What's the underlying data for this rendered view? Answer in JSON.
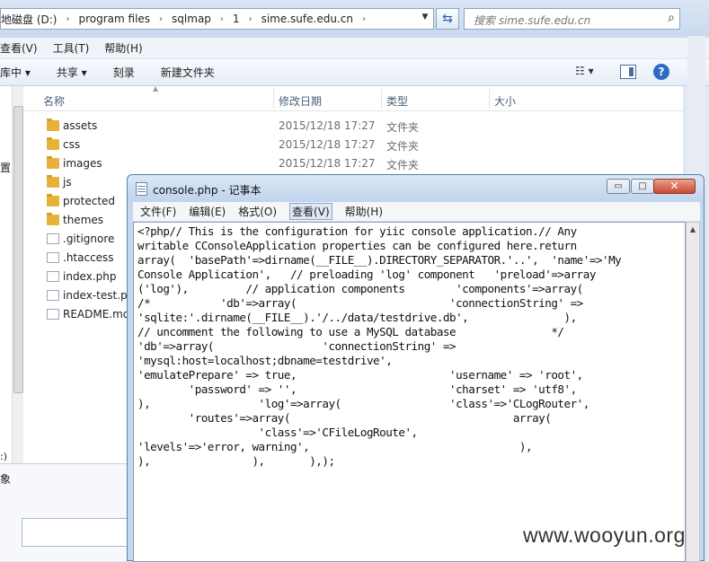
{
  "explorer": {
    "address": {
      "crumbs": [
        "地磁盘 (D:)",
        "program files",
        "sqlmap",
        "1",
        "sime.sufe.edu.cn"
      ],
      "separator": "›"
    },
    "search_placeholder": "搜索 sime.sufe.edu.cn",
    "menu": [
      "查看(V)",
      "工具(T)",
      "帮助(H)"
    ],
    "toolbar": [
      "库中 ▾",
      "共享 ▾",
      "刻录",
      "新建文件夹"
    ],
    "columns": {
      "name": "名称",
      "date": "修改日期",
      "type": "类型",
      "size": "大小"
    },
    "files": [
      {
        "name": "assets",
        "date": "2015/12/18 17:27",
        "type": "文件夹",
        "kind": "folder"
      },
      {
        "name": "css",
        "date": "2015/12/18 17:27",
        "type": "文件夹",
        "kind": "folder"
      },
      {
        "name": "images",
        "date": "2015/12/18 17:27",
        "type": "文件夹",
        "kind": "folder"
      },
      {
        "name": "js",
        "date": "",
        "type": "",
        "kind": "folder"
      },
      {
        "name": "protected",
        "date": "",
        "type": "",
        "kind": "folder"
      },
      {
        "name": "themes",
        "date": "",
        "type": "",
        "kind": "folder"
      },
      {
        "name": ".gitignore",
        "date": "",
        "type": "",
        "kind": "file"
      },
      {
        "name": ".htaccess",
        "date": "",
        "type": "",
        "kind": "file"
      },
      {
        "name": "index.php",
        "date": "",
        "type": "",
        "kind": "file"
      },
      {
        "name": "index-test.ph",
        "date": "",
        "type": "",
        "kind": "file"
      },
      {
        "name": "README.md",
        "date": "",
        "type": "",
        "kind": "file"
      }
    ],
    "left_labels": [
      "置",
      ":)",
      "象"
    ]
  },
  "notepad": {
    "title": "console.php - 记事本",
    "menu": [
      "文件(F)",
      "编辑(E)",
      "格式(O)",
      "查看(V)",
      "帮助(H)"
    ],
    "active_menu_index": 3,
    "buttons": {
      "minimize": "▭",
      "maximize": "□",
      "close": "✕"
    },
    "lines": [
      "<?php// This is the configuration for yiic console application.// Any",
      "writable CConsoleApplication properties can be configured here.return",
      "array(  'basePath'=>dirname(__FILE__).DIRECTORY_SEPARATOR.'..',  'name'=>'My",
      "Console Application',   // preloading 'log' component   'preload'=>array",
      "('log'),         // application components        'components'=>array(",
      "/*           'db'=>array(                        'connectionString' =>",
      "'sqlite:'.dirname(__FILE__).'/../data/testdrive.db',               ),",
      "// uncomment the following to use a MySQL database               */",
      "'db'=>array(                 'connectionString' =>",
      "'mysql:host=localhost;dbname=testdrive',",
      "'emulatePrepare' => true,                        'username' => 'root',",
      "        'password' => '',                        'charset' => 'utf8',",
      "),                 'log'=>array(                 'class'=>'CLogRouter',",
      "        'routes'=>array(                                   array(",
      "                   'class'=>'CFileLogRoute',",
      "'levels'=>'error, warning',                                 ),",
      "),                ),       ),);"
    ]
  },
  "watermark": "www.wooyun.org"
}
